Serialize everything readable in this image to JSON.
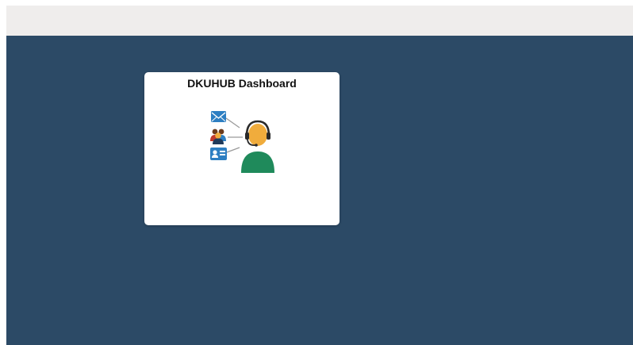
{
  "colors": {
    "top_bar": "#efedec",
    "workspace": "#2c4a66",
    "tile_background": "#ffffff",
    "agent_shirt": "#1f8a5b",
    "agent_skin": "#f0ac3c",
    "icon_blue": "#2e7fc2"
  },
  "dashboard_tile": {
    "title": "DKUHUB Dashboard",
    "icon": "call-center-agent-icon"
  }
}
